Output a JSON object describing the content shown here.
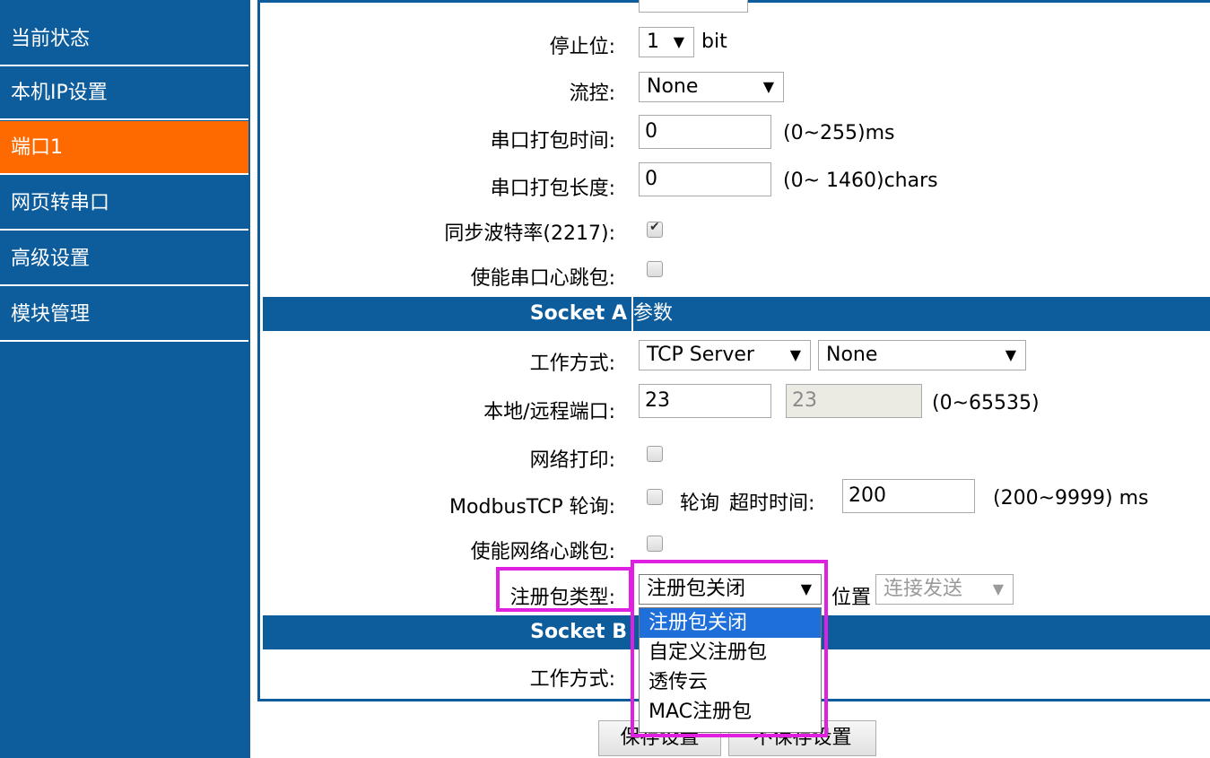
{
  "sidebar": {
    "items": [
      {
        "label": "当前状态"
      },
      {
        "label": "本机IP设置"
      },
      {
        "label": "端口1"
      },
      {
        "label": "网页转串口"
      },
      {
        "label": "高级设置"
      },
      {
        "label": "模块管理"
      }
    ],
    "active_index": 2,
    "colors": {
      "bg": "#0d5c9c",
      "active": "#ff6a00"
    }
  },
  "serial": {
    "stop_bit": {
      "label": "停止位:",
      "value": "1",
      "unit": "bit"
    },
    "flow": {
      "label": "流控:",
      "value": "None"
    },
    "pack_time": {
      "label": "串口打包时间:",
      "value": "0",
      "hint": "(0~255)ms"
    },
    "pack_len": {
      "label": "串口打包长度:",
      "value": "0",
      "hint": "(0~ 1460)chars"
    },
    "sync_baud": {
      "label": "同步波特率(2217):",
      "checked": true
    },
    "serial_heartbeat": {
      "label": "使能串口心跳包:",
      "checked": false
    }
  },
  "socket_a": {
    "header_left": "Socket A",
    "header_right": "参数",
    "work_mode": {
      "label": "工作方式:",
      "value": "TCP Server",
      "sub_value": "None"
    },
    "ports": {
      "label": "本地/远程端口:",
      "local": "23",
      "remote": "23",
      "hint": "(0~65535)"
    },
    "net_print": {
      "label": "网络打印:",
      "checked": false
    },
    "modbus": {
      "label": "ModbusTCP 轮询:",
      "checked": false,
      "poll_label": "轮询",
      "timeout_label": "超时时间:",
      "timeout_value": "200",
      "hint": "(200~9999) ms"
    },
    "net_heartbeat": {
      "label": "使能网络心跳包:",
      "checked": false
    },
    "register": {
      "label": "注册包类型:",
      "value": "注册包关闭",
      "position_label": "位置",
      "position_value": "连接发送",
      "options": [
        "注册包关闭",
        "自定义注册包",
        "透传云",
        "MAC注册包"
      ],
      "selected_option": 0
    }
  },
  "socket_b": {
    "header_left": "Socket B",
    "work_mode": {
      "label": "工作方式:"
    }
  },
  "buttons": {
    "save": "保存设置",
    "nosave": "不保存设置"
  },
  "highlight_color": "#e020e0"
}
